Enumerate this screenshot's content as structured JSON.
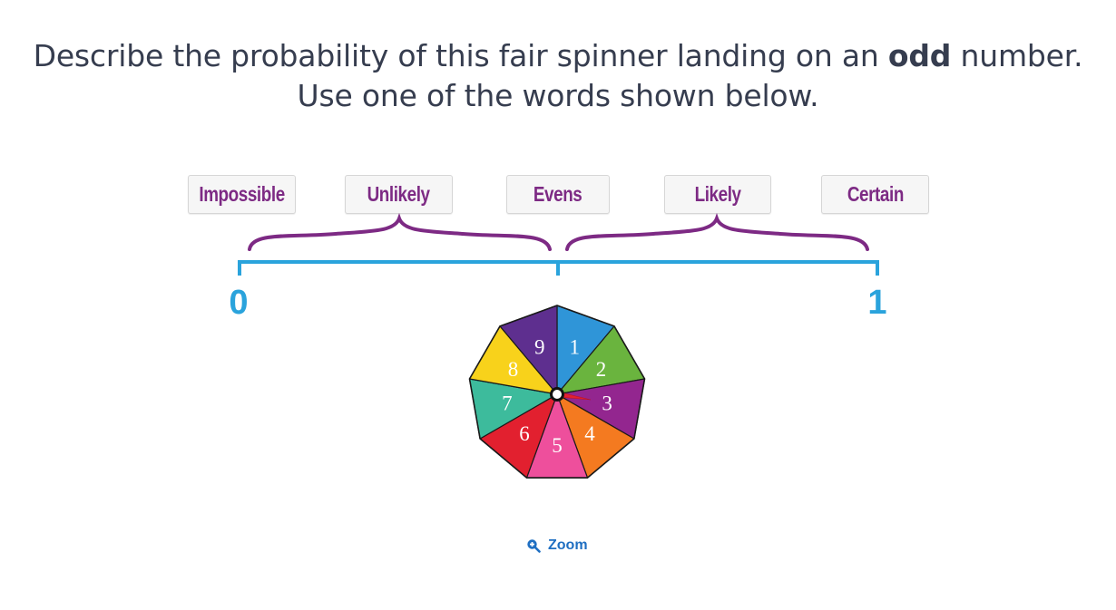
{
  "question": {
    "line1_before": "Describe the probability of this fair spinner landing on an ",
    "line1_bold": "odd",
    "line1_after": " number.",
    "line2": "Use one of the words shown below."
  },
  "options": [
    "Impossible",
    "Unlikely",
    "Evens",
    "Likely",
    "Certain"
  ],
  "scale": {
    "start_label": "0",
    "end_label": "1"
  },
  "spinner": {
    "sectors": [
      {
        "number": "1",
        "color": "#2f95d8"
      },
      {
        "number": "2",
        "color": "#6ab43e"
      },
      {
        "number": "3",
        "color": "#93268f"
      },
      {
        "number": "4",
        "color": "#f47a20"
      },
      {
        "number": "5",
        "color": "#ee4f9c"
      },
      {
        "number": "6",
        "color": "#e2202f"
      },
      {
        "number": "7",
        "color": "#3dbb9c"
      },
      {
        "number": "8",
        "color": "#f8d21b"
      },
      {
        "number": "9",
        "color": "#5e2f8f"
      }
    ]
  },
  "zoom_label": "Zoom",
  "colors": {
    "text": "#363d4f",
    "option_text": "#7d2a84",
    "bracket": "#7d2a84",
    "scale": "#2aa3dc",
    "link": "#1f6fc2"
  }
}
